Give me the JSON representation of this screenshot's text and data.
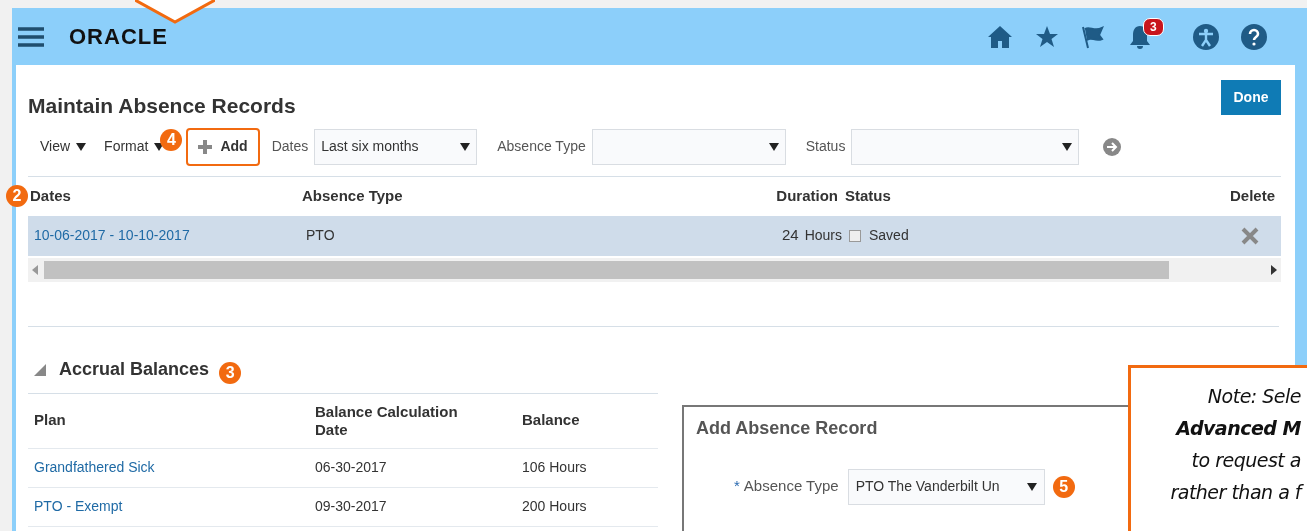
{
  "header": {
    "logo": "ORACLE",
    "notification_count": "3"
  },
  "page": {
    "title": "Maintain Absence Records",
    "done_button": "Done"
  },
  "toolbar": {
    "menus": [
      "View",
      "Format"
    ],
    "marker": "4",
    "add_button": "Add",
    "filters": [
      {
        "label": "Dates",
        "value": "Last six months"
      },
      {
        "label": "Absence Type"
      },
      {
        "label": "Status"
      }
    ]
  },
  "records": {
    "marker": "2",
    "columns": [
      "Dates",
      "Absence Type",
      "Duration",
      "Status",
      "Delete"
    ],
    "rows": [
      {
        "dates": "10-06-2017 - 10-10-2017",
        "absence_type": "PTO",
        "duration_amount": "24",
        "duration_unit": "Hours",
        "status": "Saved",
        "selected": true
      }
    ]
  },
  "accrual_balances": {
    "title": "Accrual Balances",
    "expanded": true,
    "marker": "3",
    "columns": [
      "Plan",
      "Balance Calculation Date",
      "Balance"
    ],
    "rows": [
      {
        "plan": "Grandfathered Sick",
        "date": "06-30-2017",
        "balance": "106 Hours"
      },
      {
        "plan": "PTO - Exempt",
        "date": "09-30-2017",
        "balance": "200 Hours"
      }
    ]
  },
  "add_absence_record": {
    "title": "Add Absence Record",
    "required_mark": "*",
    "field_label": "Absence Type",
    "field_value": "PTO The Vanderbilt Un",
    "marker": "5"
  },
  "note_callout": {
    "lines": [
      "Note: Sele",
      "**Advanced M**",
      "to request a",
      "rather than a f"
    ]
  }
}
